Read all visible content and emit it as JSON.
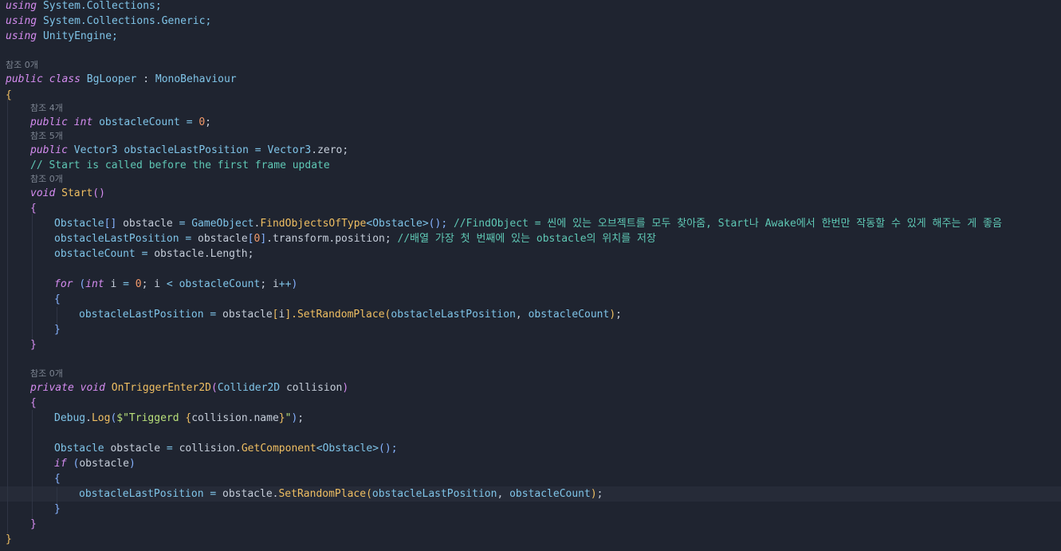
{
  "lenses": {
    "class_refs": "참조 0개",
    "count_refs": "참조 4개",
    "position_refs": "참조 5개",
    "start_refs": "참조 0개",
    "trigger_refs": "참조 0개"
  },
  "code": {
    "using1": {
      "kw": "using",
      "ns": "System.Collections;"
    },
    "using2": {
      "kw": "using",
      "ns": "System.Collections.Generic;"
    },
    "using3": {
      "kw": "using",
      "ns": "UnityEngine;"
    },
    "class_decl": {
      "mod": "public",
      "kw": "class",
      "name": "BgLooper",
      "colon": ":",
      "base": "MonoBehaviour"
    },
    "open_brace": "{",
    "field_count": {
      "mod": "public",
      "type": "int",
      "name": "obstacleCount",
      "eq": "=",
      "value": "0",
      "end": ";"
    },
    "field_pos": {
      "mod": "public",
      "type": "Vector3",
      "name": "obstacleLastPosition",
      "eq": "=",
      "value_type": "Vector3",
      "value_member": ".zero;"
    },
    "comment_start": "// Start is called before the first frame update",
    "start_decl": {
      "kw": "void",
      "name": "Start",
      "parens": "()"
    },
    "start_open": "{",
    "find_line": {
      "type": "Obstacle",
      "brackets": "[]",
      "var": "obstacle",
      "eq": "=",
      "cls": "GameObject",
      "dot": ".",
      "method": "FindObjectsOfType",
      "lt": "<",
      "generic": "Obstacle",
      "gt": ">",
      "call": "();",
      "comment": "//FindObject = 씬에 있는 오브젝트를 모두 찾아줌, Start나 Awake에서 한번만 작동할 수 있게 해주는 게 좋음"
    },
    "assign_line": {
      "target": "obstacleLastPosition",
      "eq": "=",
      "src": "obstacle",
      "lb": "[",
      "idx": "0",
      "rb": "]",
      "member": ".transform.position;",
      "comment": "//배열 가장 첫 번째에 있는 obstacle의 위치를 저장"
    },
    "count_line": {
      "target": "obstacleCount",
      "eq": "=",
      "src": "obstacle.Length;"
    },
    "for_line": {
      "kw": "for",
      "lp": "(",
      "type": "int",
      "init": "i",
      "eq": "=",
      "zero": "0",
      "sep1": ";",
      "cond_var": "i",
      "lt": "<",
      "limit": "obstacleCount",
      "sep2": ";",
      "inc": "i",
      "incop": "++",
      "rp": ")"
    },
    "for_open": "{",
    "loop_body": {
      "target": "obstacleLastPosition",
      "eq": "=",
      "src": "obstacle",
      "lb": "[",
      "idx": "i",
      "rb": "].",
      "method": "SetRandomPlace",
      "lp": "(",
      "arg1": "obstacleLastPosition",
      "comma": ",",
      "arg2": "obstacleCount",
      "rp": ")",
      "end": ";"
    },
    "for_close": "}",
    "start_close": "}",
    "trigger_decl": {
      "mod": "private",
      "kw": "void",
      "name": "OnTriggerEnter2D",
      "lp": "(",
      "ptype": "Collider2D",
      "pname": "collision",
      "rp": ")"
    },
    "trigger_open": "{",
    "debug_line": {
      "cls": "Debug",
      "dot": ".",
      "method": "Log",
      "lp": "(",
      "str_start": "$\"Triggerd ",
      "interp_open": "{",
      "interp": "collision.name",
      "interp_close": "}",
      "str_end": "\"",
      "rp": ")",
      "end": ";"
    },
    "getcomp_line": {
      "type": "Obstacle",
      "var": "obstacle",
      "eq": "=",
      "src": "collision",
      "dot": ".",
      "method": "GetComponent",
      "lt": "<",
      "generic": "Obstacle",
      "gt": ">",
      "call": "();"
    },
    "if_line": {
      "kw": "if",
      "lp": "(",
      "cond": "obstacle",
      "rp": ")"
    },
    "if_open": "{",
    "if_body": {
      "target": "obstacleLastPosition",
      "eq": "=",
      "src": "obstacle.",
      "method": "SetRandomPlace",
      "lp": "(",
      "arg1": "obstacleLastPosition",
      "comma": ",",
      "arg2": "obstacleCount",
      "rp": ")",
      "end": ";"
    },
    "if_close": "}",
    "trigger_close": "}",
    "class_close": "}"
  },
  "colors": {
    "background": "#1f2430",
    "keyword": "#d58cf0",
    "type": "#7fc4e8",
    "method": "#f0bf62",
    "number": "#f39a6b",
    "string": "#b9e07a",
    "comment": "#5fc8b5",
    "lens": "#7d8592"
  }
}
